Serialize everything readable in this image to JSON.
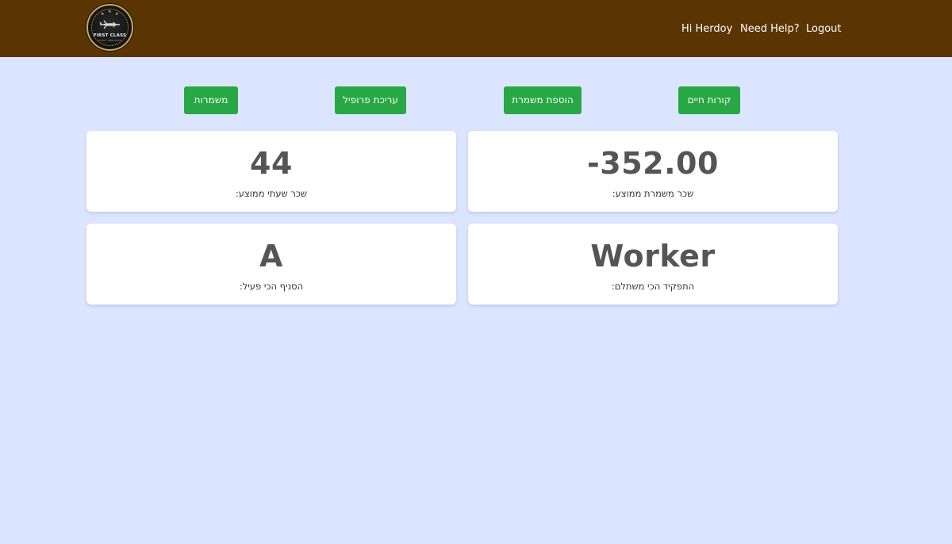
{
  "header": {
    "logo": {
      "text_main": "FIRST CLASS",
      "text_sub": "FLEET SERVICES"
    },
    "nav": {
      "greeting": "Hi Herdoy",
      "help": "Need Help?",
      "logout": "Logout"
    }
  },
  "actions": {
    "cv": "קורות חיים",
    "add_shift": "הוספת משמרת",
    "edit_profile": "עריכת פרופיל",
    "shifts": "משמרות"
  },
  "stats": {
    "avg_shift_pay": {
      "value": "-352.00",
      "label": ":שכר משמרת ממוצע"
    },
    "avg_hourly_pay": {
      "value": "44",
      "label": ":שכר שעתי ממוצע"
    },
    "top_role": {
      "value": "Worker",
      "label": ":התפקיד הכי משתלם"
    },
    "top_branch": {
      "value": "A",
      "label": ":הסניף הכי פעיל"
    }
  },
  "colors": {
    "header_bg": "#5a3403",
    "page_bg": "#dbe5ff",
    "button_green": "#27a844"
  }
}
